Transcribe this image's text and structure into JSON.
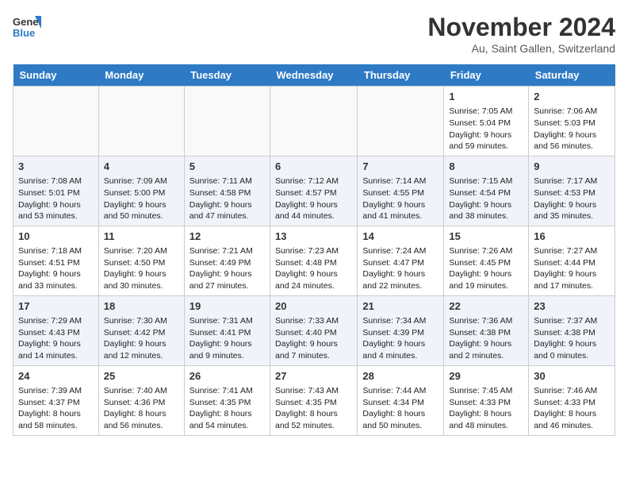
{
  "header": {
    "logo_line1": "General",
    "logo_line2": "Blue",
    "month": "November 2024",
    "location": "Au, Saint Gallen, Switzerland"
  },
  "weekdays": [
    "Sunday",
    "Monday",
    "Tuesday",
    "Wednesday",
    "Thursday",
    "Friday",
    "Saturday"
  ],
  "weeks": [
    [
      {
        "day": "",
        "info": ""
      },
      {
        "day": "",
        "info": ""
      },
      {
        "day": "",
        "info": ""
      },
      {
        "day": "",
        "info": ""
      },
      {
        "day": "",
        "info": ""
      },
      {
        "day": "1",
        "info": "Sunrise: 7:05 AM\nSunset: 5:04 PM\nDaylight: 9 hours and 59 minutes."
      },
      {
        "day": "2",
        "info": "Sunrise: 7:06 AM\nSunset: 5:03 PM\nDaylight: 9 hours and 56 minutes."
      }
    ],
    [
      {
        "day": "3",
        "info": "Sunrise: 7:08 AM\nSunset: 5:01 PM\nDaylight: 9 hours and 53 minutes."
      },
      {
        "day": "4",
        "info": "Sunrise: 7:09 AM\nSunset: 5:00 PM\nDaylight: 9 hours and 50 minutes."
      },
      {
        "day": "5",
        "info": "Sunrise: 7:11 AM\nSunset: 4:58 PM\nDaylight: 9 hours and 47 minutes."
      },
      {
        "day": "6",
        "info": "Sunrise: 7:12 AM\nSunset: 4:57 PM\nDaylight: 9 hours and 44 minutes."
      },
      {
        "day": "7",
        "info": "Sunrise: 7:14 AM\nSunset: 4:55 PM\nDaylight: 9 hours and 41 minutes."
      },
      {
        "day": "8",
        "info": "Sunrise: 7:15 AM\nSunset: 4:54 PM\nDaylight: 9 hours and 38 minutes."
      },
      {
        "day": "9",
        "info": "Sunrise: 7:17 AM\nSunset: 4:53 PM\nDaylight: 9 hours and 35 minutes."
      }
    ],
    [
      {
        "day": "10",
        "info": "Sunrise: 7:18 AM\nSunset: 4:51 PM\nDaylight: 9 hours and 33 minutes."
      },
      {
        "day": "11",
        "info": "Sunrise: 7:20 AM\nSunset: 4:50 PM\nDaylight: 9 hours and 30 minutes."
      },
      {
        "day": "12",
        "info": "Sunrise: 7:21 AM\nSunset: 4:49 PM\nDaylight: 9 hours and 27 minutes."
      },
      {
        "day": "13",
        "info": "Sunrise: 7:23 AM\nSunset: 4:48 PM\nDaylight: 9 hours and 24 minutes."
      },
      {
        "day": "14",
        "info": "Sunrise: 7:24 AM\nSunset: 4:47 PM\nDaylight: 9 hours and 22 minutes."
      },
      {
        "day": "15",
        "info": "Sunrise: 7:26 AM\nSunset: 4:45 PM\nDaylight: 9 hours and 19 minutes."
      },
      {
        "day": "16",
        "info": "Sunrise: 7:27 AM\nSunset: 4:44 PM\nDaylight: 9 hours and 17 minutes."
      }
    ],
    [
      {
        "day": "17",
        "info": "Sunrise: 7:29 AM\nSunset: 4:43 PM\nDaylight: 9 hours and 14 minutes."
      },
      {
        "day": "18",
        "info": "Sunrise: 7:30 AM\nSunset: 4:42 PM\nDaylight: 9 hours and 12 minutes."
      },
      {
        "day": "19",
        "info": "Sunrise: 7:31 AM\nSunset: 4:41 PM\nDaylight: 9 hours and 9 minutes."
      },
      {
        "day": "20",
        "info": "Sunrise: 7:33 AM\nSunset: 4:40 PM\nDaylight: 9 hours and 7 minutes."
      },
      {
        "day": "21",
        "info": "Sunrise: 7:34 AM\nSunset: 4:39 PM\nDaylight: 9 hours and 4 minutes."
      },
      {
        "day": "22",
        "info": "Sunrise: 7:36 AM\nSunset: 4:38 PM\nDaylight: 9 hours and 2 minutes."
      },
      {
        "day": "23",
        "info": "Sunrise: 7:37 AM\nSunset: 4:38 PM\nDaylight: 9 hours and 0 minutes."
      }
    ],
    [
      {
        "day": "24",
        "info": "Sunrise: 7:39 AM\nSunset: 4:37 PM\nDaylight: 8 hours and 58 minutes."
      },
      {
        "day": "25",
        "info": "Sunrise: 7:40 AM\nSunset: 4:36 PM\nDaylight: 8 hours and 56 minutes."
      },
      {
        "day": "26",
        "info": "Sunrise: 7:41 AM\nSunset: 4:35 PM\nDaylight: 8 hours and 54 minutes."
      },
      {
        "day": "27",
        "info": "Sunrise: 7:43 AM\nSunset: 4:35 PM\nDaylight: 8 hours and 52 minutes."
      },
      {
        "day": "28",
        "info": "Sunrise: 7:44 AM\nSunset: 4:34 PM\nDaylight: 8 hours and 50 minutes."
      },
      {
        "day": "29",
        "info": "Sunrise: 7:45 AM\nSunset: 4:33 PM\nDaylight: 8 hours and 48 minutes."
      },
      {
        "day": "30",
        "info": "Sunrise: 7:46 AM\nSunset: 4:33 PM\nDaylight: 8 hours and 46 minutes."
      }
    ]
  ]
}
